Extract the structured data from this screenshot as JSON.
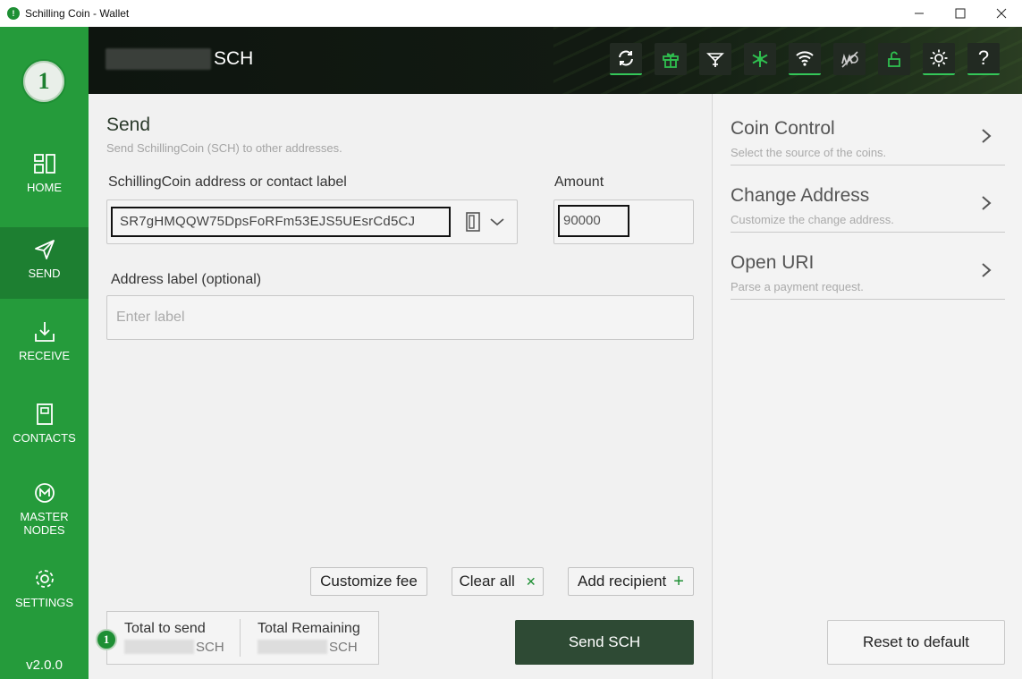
{
  "window": {
    "title": "Schilling Coin - Wallet",
    "app_icon_glyph": "!",
    "controls": {
      "minimize": "—",
      "maximize": "☐",
      "close": "✕"
    }
  },
  "sidebar": {
    "logo_glyph": "1",
    "items": [
      {
        "label": "HOME",
        "icon": "home-grid-icon",
        "active": false
      },
      {
        "label": "SEND",
        "icon": "paper-plane-icon",
        "active": true
      },
      {
        "label": "RECEIVE",
        "icon": "download-icon",
        "active": false
      },
      {
        "label": "CONTACTS",
        "icon": "address-book-icon",
        "active": false
      },
      {
        "label": "MASTER\nNODES",
        "label_line1": "MASTER",
        "label_line2": "NODES",
        "icon": "masternode-icon",
        "active": false
      },
      {
        "label": "SETTINGS",
        "icon": "gear-icon",
        "active": false
      }
    ],
    "version": "v2.0.0"
  },
  "header": {
    "balance_unit": "SCH",
    "toolbar": [
      {
        "name": "sync-icon",
        "active": true
      },
      {
        "name": "gift-icon",
        "active": false
      },
      {
        "name": "hot-staking-icon",
        "active": false
      },
      {
        "name": "cold-staking-icon",
        "active": false
      },
      {
        "name": "wifi-icon",
        "active": true
      },
      {
        "name": "tor-disabled-icon",
        "active": false
      },
      {
        "name": "unlock-icon",
        "active": false
      },
      {
        "name": "theme-sun-icon",
        "active": true
      },
      {
        "name": "help-icon",
        "active": true,
        "glyph": "?"
      }
    ],
    "accent_color": "#34c759"
  },
  "send": {
    "title": "Send",
    "subtitle": "Send SchillingCoin (SCH) to other addresses.",
    "address_label": "SchillingCoin address or contact label",
    "address_value": "SR7gHMQQW75DpsFoRFm53EJS5UEsrCd5CJ",
    "amount_label": "Amount",
    "amount_value": "90000",
    "addr_label_label": "Address label (optional)",
    "addr_label_placeholder": "Enter label",
    "customize_fee": "Customize fee",
    "clear_all": "Clear all",
    "clear_all_icon": "✕",
    "add_recipient": "Add recipient",
    "add_recipient_icon": "+",
    "total_to_send_label": "Total to send",
    "total_to_send_unit": "SCH",
    "total_remaining_label": "Total Remaining",
    "total_remaining_unit": "SCH",
    "send_button": "Send SCH",
    "coin_badge_glyph": "1"
  },
  "options": {
    "items": [
      {
        "title": "Coin Control",
        "subtitle": "Select the source of the coins."
      },
      {
        "title": "Change Address",
        "subtitle": "Customize the change address."
      },
      {
        "title": "Open URI",
        "subtitle": "Parse a payment request."
      }
    ],
    "reset_button": "Reset to default"
  },
  "colors": {
    "sidebar_green": "#259b3b",
    "sidebar_active": "#1d7f31",
    "send_button": "#2e4a34",
    "header_dark": "#121a12"
  }
}
